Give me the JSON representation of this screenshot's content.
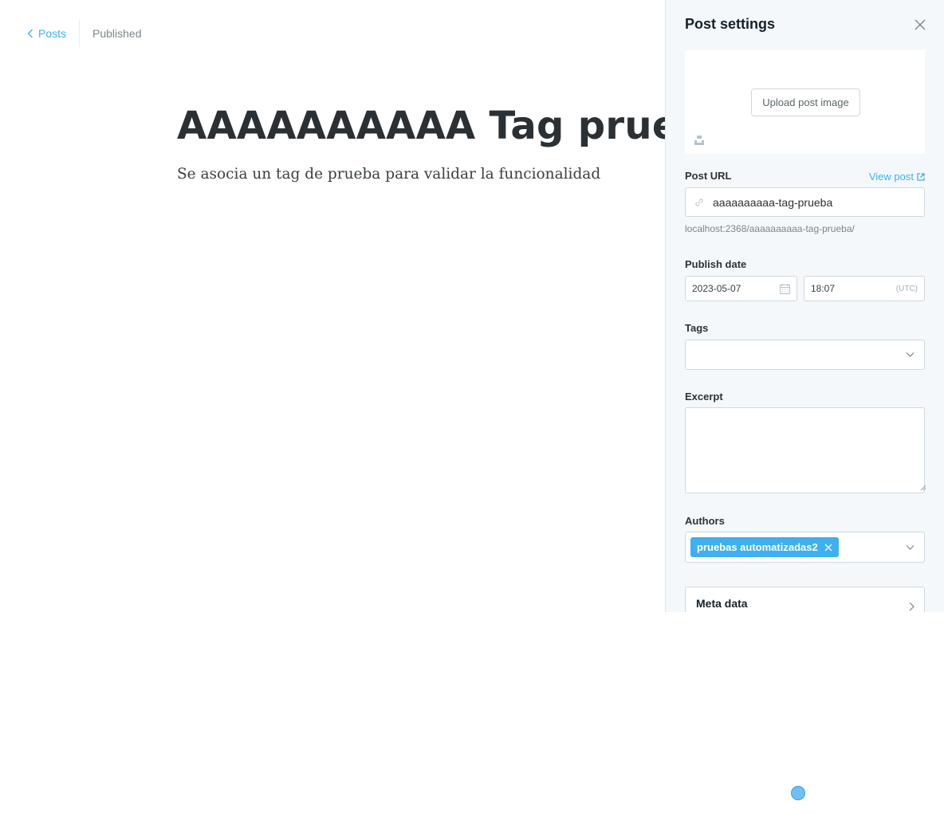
{
  "header": {
    "back_label": "Posts",
    "status": "Published"
  },
  "post": {
    "title": "AAAAAAAAAA Tag prueba",
    "body": "Se asocia un tag de prueba para validar la funcionalidad"
  },
  "settings": {
    "title": "Post settings",
    "upload_label": "Upload post image",
    "post_url": {
      "label": "Post URL",
      "view_post_label": "View post",
      "value": "aaaaaaaaaa-tag-prueba",
      "hint": "localhost:2368/aaaaaaaaaa-tag-prueba/"
    },
    "publish_date": {
      "label": "Publish date",
      "date": "2023-05-07",
      "time": "18:07",
      "timezone": "(UTC)"
    },
    "tags": {
      "label": "Tags"
    },
    "excerpt": {
      "label": "Excerpt",
      "value": ""
    },
    "authors": {
      "label": "Authors",
      "selected": [
        "pruebas automatizadas2"
      ]
    },
    "meta_data": {
      "label": "Meta data"
    }
  },
  "colors": {
    "accent": "#3eb0ef",
    "panel_bg": "#f4f8fb",
    "title_text": "#2b3034"
  }
}
